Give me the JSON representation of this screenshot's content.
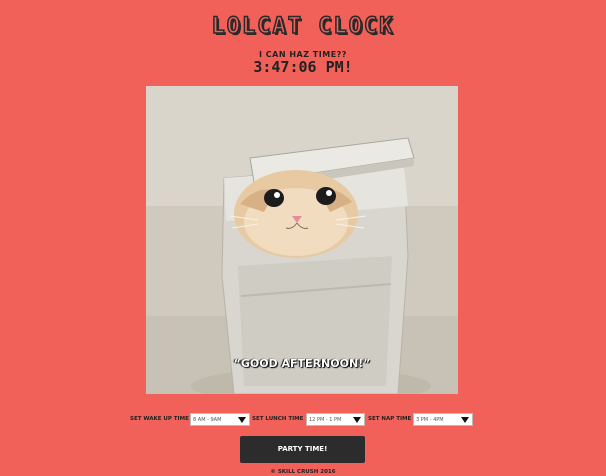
{
  "header": {
    "title": "LOLCAT CLOCK",
    "subtitle": "I CAN HAZ TIME??",
    "clock_time": "3:47:06 PM!"
  },
  "photo": {
    "message": "“GOOD AFTERNOON!”"
  },
  "controls": {
    "wake_label": "SET WAKE UP TIME",
    "wake_value": "8 AM - 9AM",
    "lunch_label": "SET LUNCH TIME",
    "lunch_value": "12 PM - 1 PM",
    "nap_label": "SET NAP TIME",
    "nap_value": "3 PM - 4PM",
    "party_button": "PARTY TIME!"
  },
  "footer": {
    "text": "© SKILL CRUSH 2016"
  },
  "colors": {
    "background": "#f1615a",
    "button": "#2c2c2c",
    "text_dark": "#222222"
  }
}
